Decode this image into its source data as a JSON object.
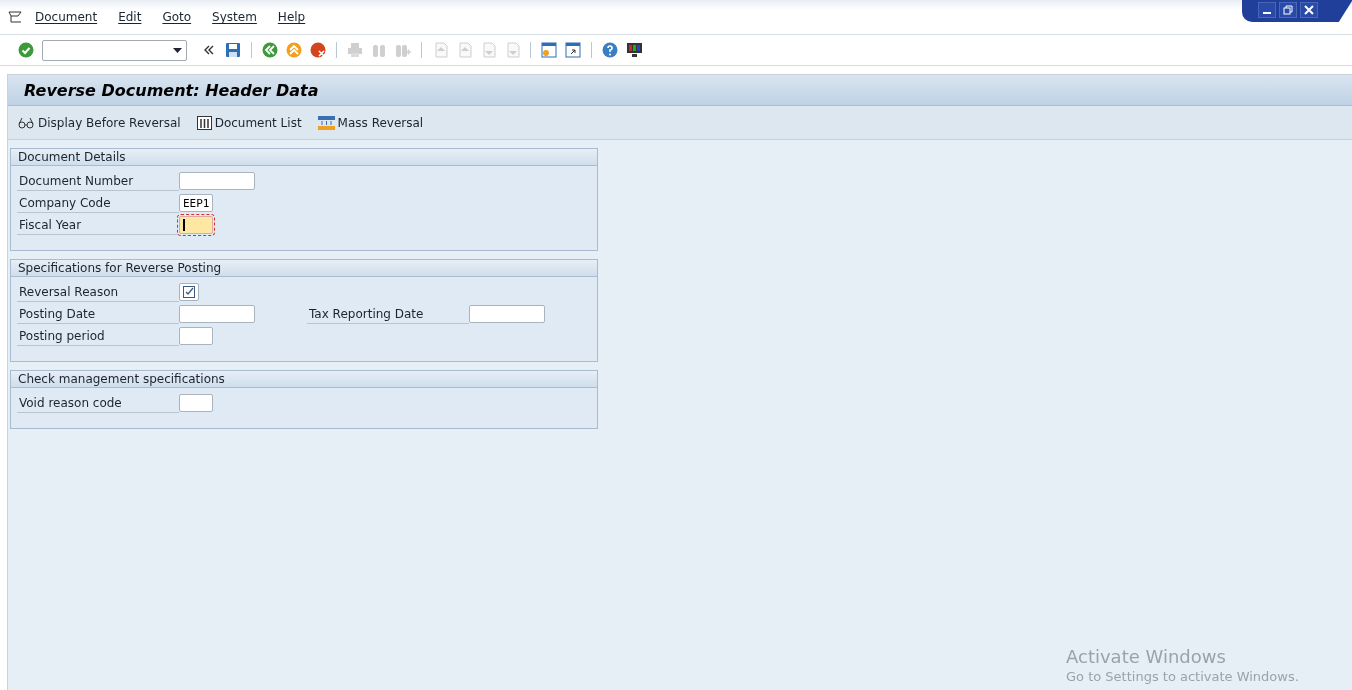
{
  "menu": [
    {
      "label": "Document"
    },
    {
      "label": "Edit"
    },
    {
      "label": "Goto"
    },
    {
      "label": "System"
    },
    {
      "label": "Help"
    }
  ],
  "toolbar": [
    {
      "kind": "enter",
      "disabled": false
    },
    {
      "kind": "command"
    },
    {
      "kind": "collapse",
      "disabled": false
    },
    {
      "kind": "save",
      "disabled": false
    },
    {
      "kind": "sep"
    },
    {
      "kind": "back",
      "disabled": false
    },
    {
      "kind": "exit",
      "disabled": false
    },
    {
      "kind": "cancel",
      "disabled": false
    },
    {
      "kind": "sep"
    },
    {
      "kind": "print",
      "disabled": true
    },
    {
      "kind": "find",
      "disabled": true
    },
    {
      "kind": "find-next",
      "disabled": true
    },
    {
      "kind": "sep"
    },
    {
      "kind": "first",
      "disabled": true
    },
    {
      "kind": "prev",
      "disabled": true
    },
    {
      "kind": "next",
      "disabled": true
    },
    {
      "kind": "last",
      "disabled": true
    },
    {
      "kind": "sep"
    },
    {
      "kind": "new-session",
      "disabled": false
    },
    {
      "kind": "shortcut",
      "disabled": false
    },
    {
      "kind": "sep"
    },
    {
      "kind": "help",
      "disabled": false
    },
    {
      "kind": "layout",
      "disabled": false
    }
  ],
  "title": "Reverse Document: Header Data",
  "app_toolbar": [
    {
      "kind": "glasses",
      "label": "Display Before Reversal"
    },
    {
      "kind": "list",
      "label": "Document List"
    },
    {
      "kind": "mass",
      "label": "Mass Reversal"
    }
  ],
  "groups": [
    {
      "title": "Document Details",
      "rows": [
        [
          {
            "label": "Document Number",
            "kind": "wide",
            "focused": false
          }
        ],
        [
          {
            "label": "Company Code",
            "kind": "narrow",
            "value": "EEP1",
            "focused": false
          }
        ],
        [
          {
            "label": "Fiscal Year",
            "kind": "narrow",
            "focused": true
          }
        ]
      ]
    },
    {
      "title": "Specifications for Reverse Posting",
      "rows": [
        [
          {
            "label": "Reversal Reason",
            "kind": "help",
            "focused": false
          }
        ],
        [
          {
            "label": "Posting Date",
            "kind": "wide",
            "focused": false
          },
          {
            "label": "Tax Reporting Date",
            "kind": "wide",
            "focused": false
          }
        ],
        [
          {
            "label": "Posting period",
            "kind": "narrow",
            "focused": false
          }
        ]
      ]
    },
    {
      "title": "Check management specifications",
      "rows": [
        [
          {
            "label": "Void reason code",
            "kind": "narrow",
            "focused": false
          }
        ]
      ]
    }
  ],
  "notice": {
    "title": "Activate Windows",
    "text": "Go to Settings to activate Windows."
  }
}
